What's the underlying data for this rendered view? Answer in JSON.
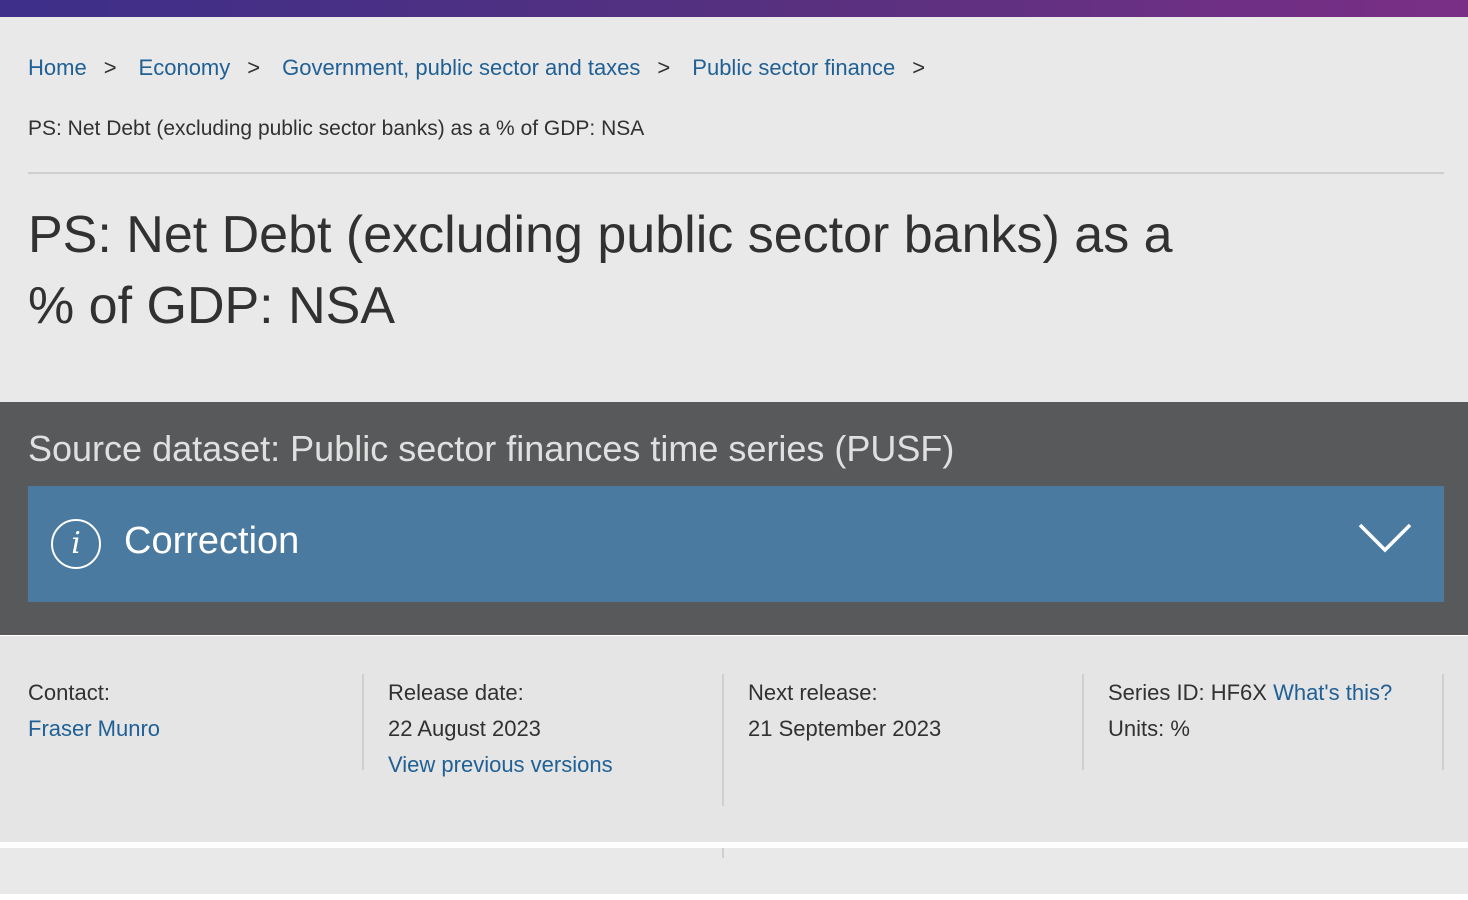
{
  "breadcrumb": {
    "items": [
      "Home",
      "Economy",
      "Government, public sector and taxes",
      "Public sector finance"
    ],
    "separator": ">",
    "current": "PS: Net Debt (excluding public sector banks) as a % of GDP: NSA"
  },
  "page": {
    "title": "PS: Net Debt (excluding public sector banks) as a % of GDP: NSA"
  },
  "dataset": {
    "source_label": "Source dataset: Public sector finances time series (PUSF)"
  },
  "correction": {
    "label": "Correction",
    "icon": "info-icon",
    "toggle_icon": "chevron-down-icon"
  },
  "meta": {
    "contact_label": "Contact:",
    "contact_name": "Fraser Munro",
    "release_label": "Release date:",
    "release_date": "22 August 2023",
    "previous_versions": "View previous versions",
    "next_release_label": "Next release:",
    "next_release_date": "21 September 2023",
    "series_id": "Series ID: HF6X",
    "whats_this": "What's this?",
    "units": "Units: %"
  },
  "colors": {
    "brand_gradient_start": "#3d2f8a",
    "brand_gradient_end": "#7a2f86",
    "link": "#206095",
    "dataset_band": "#58595b",
    "correction_banner": "#4a7a9f",
    "header_bg": "#e9e9e9"
  }
}
